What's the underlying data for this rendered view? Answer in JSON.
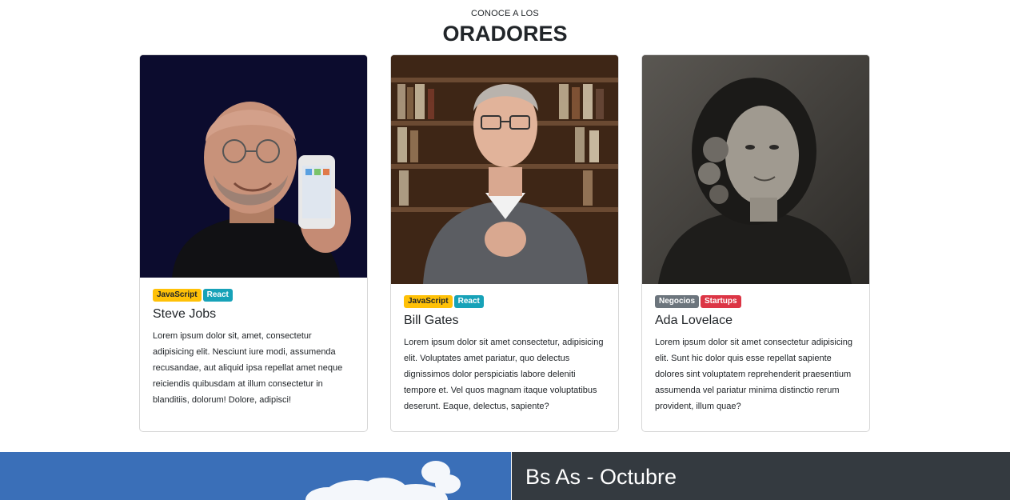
{
  "header": {
    "kicker": "CONOCE A LOS",
    "title": "ORADORES"
  },
  "speakers": [
    {
      "name": "Steve Jobs",
      "badges": [
        {
          "label": "JavaScript",
          "color": "#ffc107"
        },
        {
          "label": "React",
          "color": "#17a2b8"
        }
      ],
      "description": "Lorem ipsum dolor sit, amet, consectetur adipisicing elit. Nesciunt iure modi, assumenda recusandae, aut aliquid ipsa repellat amet neque reiciendis quibusdam at illum consectetur in blanditiis, dolorum! Dolore, adipisci!",
      "photo_icon": "portrait-photo"
    },
    {
      "name": "Bill Gates",
      "badges": [
        {
          "label": "JavaScript",
          "color": "#ffc107"
        },
        {
          "label": "React",
          "color": "#17a2b8"
        }
      ],
      "description": "Lorem ipsum dolor sit amet consectetur, adipisicing elit. Voluptates amet pariatur, quo delectus dignissimos dolor perspiciatis labore deleniti tempore et. Vel quos magnam itaque voluptatibus deserunt. Eaque, delectus, sapiente?",
      "photo_icon": "portrait-photo"
    },
    {
      "name": "Ada Lovelace",
      "badges": [
        {
          "label": "Negocios",
          "color": "#6c757d"
        },
        {
          "label": "Startups",
          "color": "#dc3545"
        }
      ],
      "description": "Lorem ipsum dolor sit amet consectetur adipisicing elit. Sunt hic dolor quis esse repellat sapiente dolores sint voluptatem reprehenderit praesentium assumenda vel pariatur minima distinctio rerum provident, illum quae?",
      "photo_icon": "portrait-photo"
    }
  ],
  "event": {
    "title": "Bs As - Octubre"
  },
  "colors": {
    "dark_panel": "#343a40",
    "sky": "#3f76c0"
  }
}
